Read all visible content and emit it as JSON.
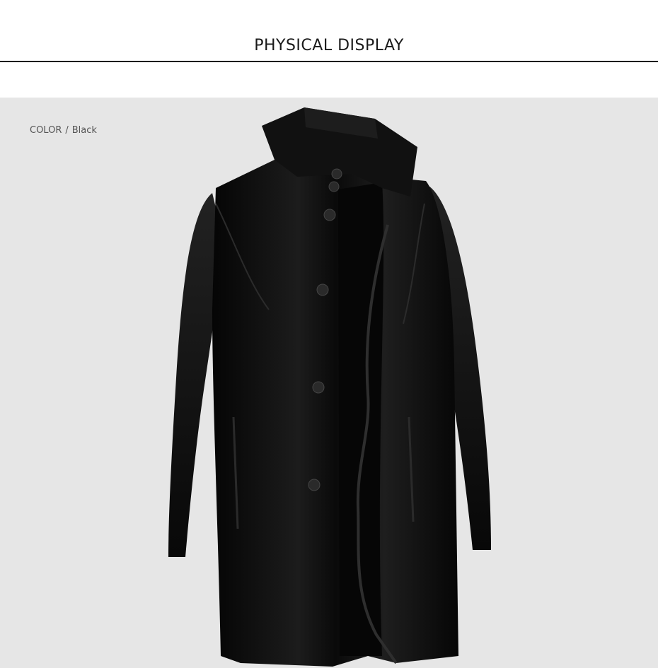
{
  "header": {
    "title": "PHYSICAL DISPLAY"
  },
  "product": {
    "color_label": "COLOR",
    "separator": "/",
    "color_value": "Black"
  },
  "colors": {
    "page_background": "#ffffff",
    "display_background": "#e6e6e6",
    "coat": "#0d0d0d",
    "rule": "#1a1a1a"
  }
}
